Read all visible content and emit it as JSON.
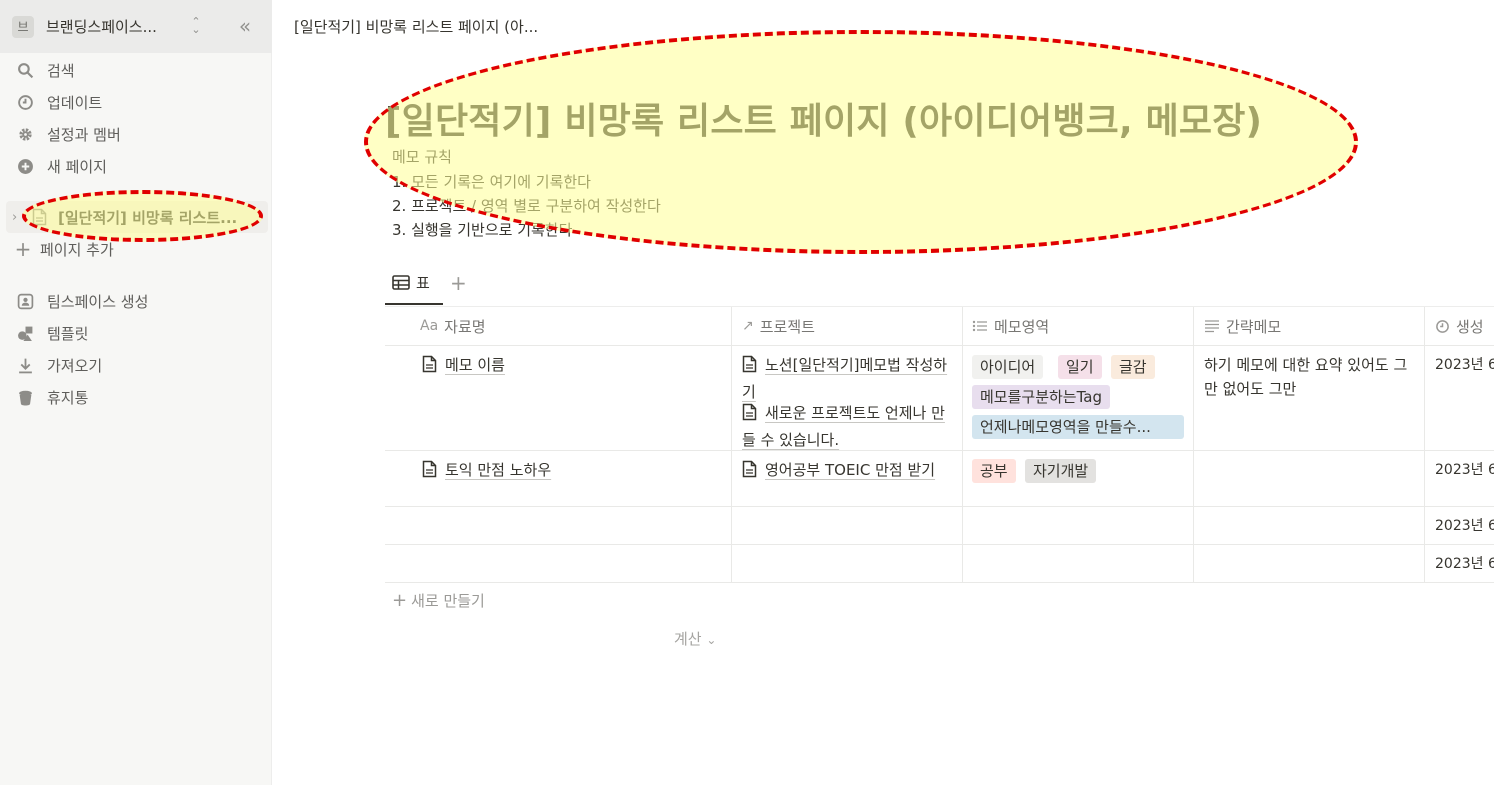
{
  "sidebar": {
    "workspace_avatar": "브",
    "workspace_name": "브랜딩스페이스...",
    "nav": [
      {
        "label": "검색",
        "icon": "search-icon"
      },
      {
        "label": "업데이트",
        "icon": "clock-icon"
      },
      {
        "label": "설정과 멤버",
        "icon": "gear-icon"
      },
      {
        "label": "새 페이지",
        "icon": "plus-circle-icon"
      }
    ],
    "current_page": "[일단적기] 비망록 리스트...",
    "add_page": "페이지 추가",
    "bottom_nav": [
      {
        "label": "팀스페이스 생성",
        "icon": "teamspace-icon"
      },
      {
        "label": "템플릿",
        "icon": "shapes-icon"
      },
      {
        "label": "가져오기",
        "icon": "download-icon"
      },
      {
        "label": "휴지통",
        "icon": "trash-icon"
      }
    ]
  },
  "breadcrumb": "[일단적기] 비망록 리스트 페이지 (아...",
  "page": {
    "title": "[일단적기] 비망록 리스트 페이지 (아이디어뱅크, 메모장)",
    "description": [
      "메모 규칙",
      "1. 모든 기록은 여기에 기록한다",
      "2. 프로젝트 / 영역 별로 구분하여 작성한다",
      "3. 실행을 기반으로 기록한다"
    ]
  },
  "view": {
    "tab_label": "표",
    "add_view": "+"
  },
  "table": {
    "columns": [
      {
        "icon": "Aa",
        "label": "자료명"
      },
      {
        "icon": "↗",
        "label": "프로젝트"
      },
      {
        "icon": "list-icon",
        "label": "메모영역"
      },
      {
        "icon": "lines-icon",
        "label": "간략메모"
      },
      {
        "icon": "clock-icon",
        "label": "생성"
      }
    ],
    "rows": [
      {
        "name": "메모 이름",
        "projects": [
          "노션[일단적기]메모법 작성하기",
          "새로운 프로젝트도 언제나 만들 수 있습니다."
        ],
        "tags": [
          "아이디어",
          "일기",
          "글감",
          "메모를구분하는Tag",
          "언제나메모영역을 만들수..."
        ],
        "memo": "하기 메모에 대한 요약 있어도 그만 없어도 그만",
        "created": "2023년 6"
      },
      {
        "name": "토익 만점 노하우",
        "projects": [
          "영어공부 TOEIC 만점 받기"
        ],
        "tags": [
          "공부",
          "자기개발"
        ],
        "memo": "",
        "created": "2023년 6"
      },
      {
        "name": "",
        "projects": [],
        "tags": [],
        "memo": "",
        "created": "2023년 6"
      },
      {
        "name": "",
        "projects": [],
        "tags": [],
        "memo": "",
        "created": "2023년 6"
      }
    ],
    "new_row": "새로 만들기",
    "calculate": "계산"
  },
  "colors": {
    "tag_gray": "#f1f1ef",
    "tag_pink": "#f5e0e9",
    "tag_orange": "#faebdd",
    "tag_purple": "#e8deee",
    "tag_blue": "#d3e5ef",
    "tag_red": "#ffe2dd",
    "tag_gray2": "#e3e2e0",
    "annotation_red": "#e00000"
  }
}
